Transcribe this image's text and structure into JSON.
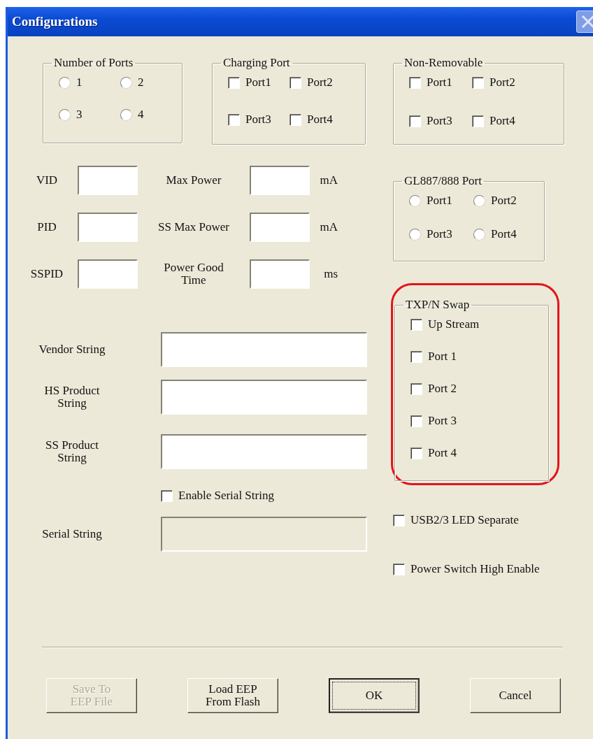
{
  "window": {
    "title": "Configurations"
  },
  "number_of_ports": {
    "title": "Number of Ports",
    "options": [
      {
        "label": "1",
        "selected": false
      },
      {
        "label": "2",
        "selected": false
      },
      {
        "label": "3",
        "selected": false
      },
      {
        "label": "4",
        "selected": false
      }
    ]
  },
  "charging_port": {
    "title": "Charging Port",
    "options": [
      {
        "label": "Port1",
        "checked": false
      },
      {
        "label": "Port2",
        "checked": false
      },
      {
        "label": "Port3",
        "checked": false
      },
      {
        "label": "Port4",
        "checked": false
      }
    ]
  },
  "fields": [
    {
      "label": "VID"
    },
    {
      "label": "Max Power",
      "unit": "mA"
    },
    {
      "label": "PID"
    },
    {
      "label": "SS Max Power",
      "unit": "mA"
    },
    {
      "label": "SSPID"
    },
    {
      "label": "Power Good Time",
      "unit": "ms"
    }
  ],
  "strings": [
    {
      "kind": "field",
      "label": "Vendor String",
      "disabled": false
    },
    {
      "kind": "field",
      "label": "HS Product String",
      "disabled": false
    },
    {
      "kind": "field",
      "label": "SS Product String",
      "disabled": false
    },
    {
      "kind": "checkbox",
      "label": "Enable Serial String",
      "checked": false
    },
    {
      "kind": "field",
      "label": "Serial String",
      "disabled": true
    }
  ],
  "non_removable": {
    "title": "Non-Removable",
    "options": [
      {
        "label": "Port1",
        "checked": false
      },
      {
        "label": "Port2",
        "checked": false
      },
      {
        "label": "Port3",
        "checked": false
      },
      {
        "label": "Port4",
        "checked": false
      }
    ]
  },
  "gl887_888_port": {
    "title": "GL887/888 Port",
    "options": [
      {
        "label": "Port1",
        "selected": false
      },
      {
        "label": "Port2",
        "selected": false
      },
      {
        "label": "Port3",
        "selected": false
      },
      {
        "label": "Port4",
        "selected": false
      }
    ]
  },
  "txpn_swap": {
    "title": "TXP/N Swap",
    "highlighted": true,
    "options": [
      {
        "label": "Up Stream",
        "checked": false
      },
      {
        "label": "Port 1",
        "checked": false
      },
      {
        "label": "Port 2",
        "checked": false
      },
      {
        "label": "Port 3",
        "checked": false
      },
      {
        "label": "Port 4",
        "checked": false
      }
    ]
  },
  "extra_options": [
    {
      "label": "USB2/3 LED Separate",
      "checked": false
    },
    {
      "label": "Power Switch High Enable",
      "checked": false
    }
  ],
  "buttons": [
    {
      "label": "Save To\nEEP File",
      "disabled": true,
      "default": false
    },
    {
      "label": "Load EEP\nFrom Flash",
      "disabled": false,
      "default": false
    },
    {
      "label": "OK",
      "disabled": false,
      "default": true
    },
    {
      "label": "Cancel",
      "disabled": false,
      "default": false
    }
  ]
}
